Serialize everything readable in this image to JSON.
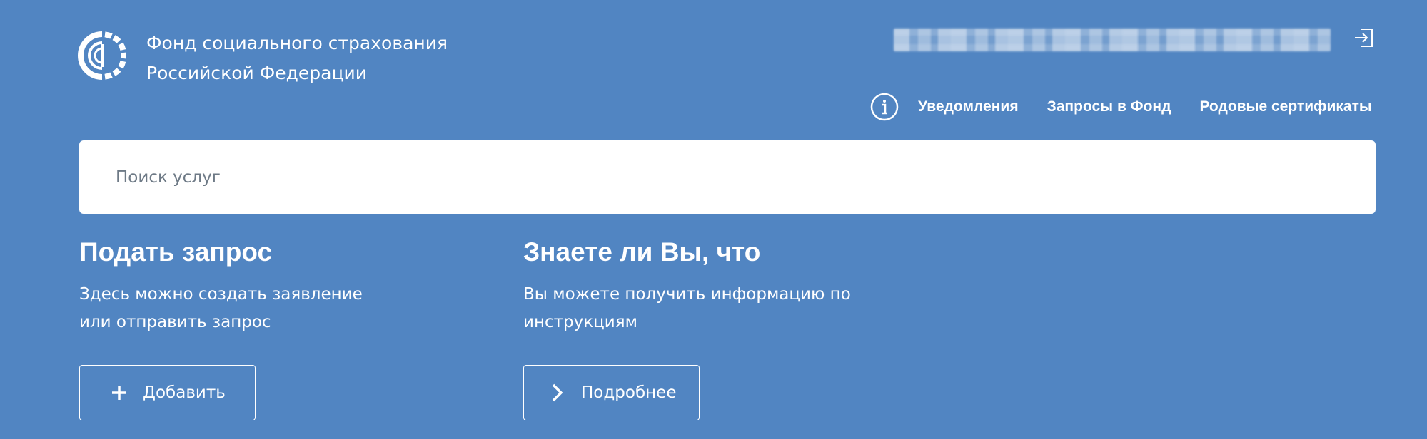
{
  "header": {
    "org_line1": "Фонд социального страхования",
    "org_line2": "Российской Федерации",
    "logo_icon": "fss-logo-icon",
    "user_name": "████████████████████████",
    "logout_icon": "logout-icon"
  },
  "nav": {
    "info_icon": "info-icon",
    "items": [
      {
        "label": "Уведомления"
      },
      {
        "label": "Запросы в Фонд"
      },
      {
        "label": "Родовые сертификаты"
      }
    ]
  },
  "search": {
    "placeholder": "Поиск услуг",
    "value": ""
  },
  "cards": {
    "submit": {
      "title": "Подать запрос",
      "text_line1": "Здесь можно создать заявление",
      "text_line2": "или отправить запрос",
      "button_label": "Добавить",
      "button_icon": "plus-icon"
    },
    "info": {
      "title": "Знаете ли Вы, что",
      "text_line1": "Вы можете получить информацию по",
      "text_line2": "инструкциям",
      "button_label": "Подробнее",
      "button_icon": "chevron-right-icon"
    }
  },
  "colors": {
    "background": "#5185c2",
    "text": "#ffffff",
    "search_bg": "#ffffff",
    "placeholder": "#6e7a86"
  }
}
